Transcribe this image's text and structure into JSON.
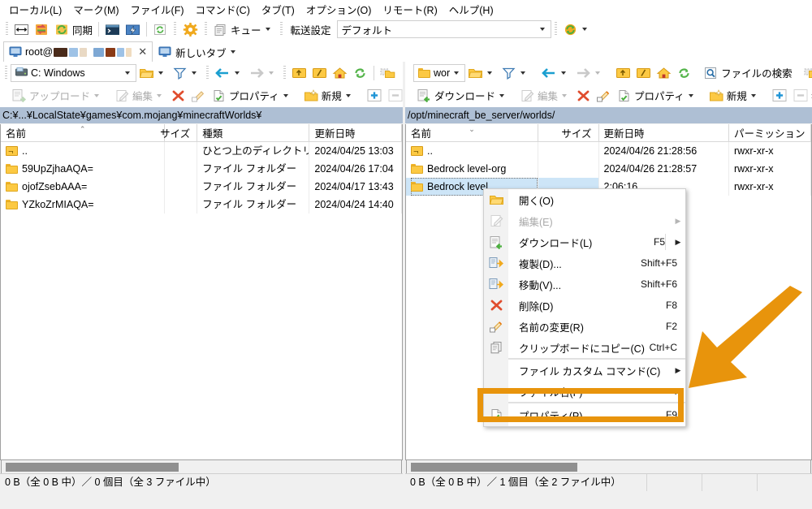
{
  "menubar": [
    {
      "label": "ローカル(L)"
    },
    {
      "label": "マーク(M)"
    },
    {
      "label": "ファイル(F)"
    },
    {
      "label": "コマンド(C)"
    },
    {
      "label": "タブ(T)"
    },
    {
      "label": "オプション(O)"
    },
    {
      "label": "リモート(R)"
    },
    {
      "label": "ヘルプ(H)"
    }
  ],
  "toolbar": {
    "sync_label": "同期",
    "queue_label": "キュー",
    "transfer_settings_label": "転送設定",
    "transfer_settings_value": "デフォルト"
  },
  "tabs": {
    "session_prefix": "root@",
    "new_tab_label": "新しいタブ",
    "close_glyph": "✕"
  },
  "left": {
    "drive_label": "C: Windows",
    "upload_label": "アップロード",
    "edit_label": "編集",
    "properties_label": "プロパティ",
    "new_label": "新規",
    "overflow_label": "»",
    "path": "C:¥...¥LocalState¥games¥com.mojang¥minecraftWorlds¥",
    "columns": [
      "名前",
      "サイズ",
      "種類",
      "更新日時"
    ],
    "rows": [
      {
        "name": "..",
        "size": "",
        "type": "ひとつ上のディレクトリ",
        "modified": "2024/04/25 13:03",
        "icon": "parent-dir-icon"
      },
      {
        "name": "59UpZjhaAQA=",
        "size": "",
        "type": "ファイル フォルダー",
        "modified": "2024/04/26 17:04",
        "icon": "folder-icon"
      },
      {
        "name": "ojofZsebAAA=",
        "size": "",
        "type": "ファイル フォルダー",
        "modified": "2024/04/17 13:43",
        "icon": "folder-icon"
      },
      {
        "name": "YZkoZrMIAQA=",
        "size": "",
        "type": "ファイル フォルダー",
        "modified": "2024/04/24 14:40",
        "icon": "folder-icon"
      }
    ],
    "status": "0 B（全 0 B 中）／ 0 個目（全 3 ファイル中）"
  },
  "right": {
    "dir_label": "wor",
    "file_search_label": "ファイルの検索",
    "download_label": "ダウンロード",
    "edit_label": "編集",
    "properties_label": "プロパティ",
    "new_label": "新規",
    "overflow_label": "»",
    "path": "/opt/minecraft_be_server/worlds/",
    "columns": [
      "名前",
      "サイズ",
      "更新日時",
      "パーミッション"
    ],
    "rows": [
      {
        "name": "..",
        "size": "",
        "modified": "2024/04/26 21:28:56",
        "perm": "rwxr-xr-x",
        "icon": "parent-dir-icon",
        "selected": false
      },
      {
        "name": "Bedrock level-org",
        "size": "",
        "modified": "2024/04/26 21:28:57",
        "perm": "rwxr-xr-x",
        "icon": "folder-icon",
        "selected": false
      },
      {
        "name": "Bedrock level",
        "size": "",
        "modified": "2:06:16",
        "perm": "rwxr-xr-x",
        "icon": "folder-icon",
        "selected": true
      }
    ],
    "status": "0 B（全 0 B 中）／ 1 個目（全 2 ファイル中）"
  },
  "context_menu": {
    "items": [
      {
        "label": "開く(O)",
        "shortcut": "",
        "icon": "open-folder-icon",
        "disabled": false,
        "submenu": false
      },
      {
        "label": "編集(E)",
        "shortcut": "",
        "icon": "edit-pencil-icon",
        "disabled": true,
        "submenu": true
      },
      {
        "label": "ダウンロード(L)",
        "shortcut": "F5",
        "icon": "download-icon",
        "disabled": false,
        "submenu": true
      },
      {
        "label": "複製(D)...",
        "shortcut": "Shift+F5",
        "icon": "duplicate-icon",
        "disabled": false,
        "submenu": false
      },
      {
        "label": "移動(V)...",
        "shortcut": "Shift+F6",
        "icon": "move-icon",
        "disabled": false,
        "submenu": false
      },
      {
        "label": "削除(D)",
        "shortcut": "F8",
        "icon": "delete-x-icon",
        "disabled": false,
        "submenu": false
      },
      {
        "label": "名前の変更(R)",
        "shortcut": "F2",
        "icon": "rename-icon",
        "disabled": false,
        "submenu": false
      },
      {
        "label": "クリップボードにコピー(C)",
        "shortcut": "Ctrl+C",
        "icon": "copy-clipboard-icon",
        "disabled": false,
        "submenu": false
      },
      {
        "label": "ファイル カスタム コマンド(C)",
        "shortcut": "",
        "icon": "none",
        "disabled": false,
        "submenu": true
      },
      {
        "label": "ファイル名(F)",
        "shortcut": "",
        "icon": "none",
        "disabled": false,
        "submenu": true
      },
      {
        "label": "プロパティ(P)",
        "shortcut": "F9",
        "icon": "properties-icon",
        "disabled": false,
        "submenu": false
      }
    ]
  },
  "annotation": {
    "highlight_color": "#e8940c",
    "arrow_color": "#e8940c",
    "highlighted_item": "プロパティ(P)"
  }
}
